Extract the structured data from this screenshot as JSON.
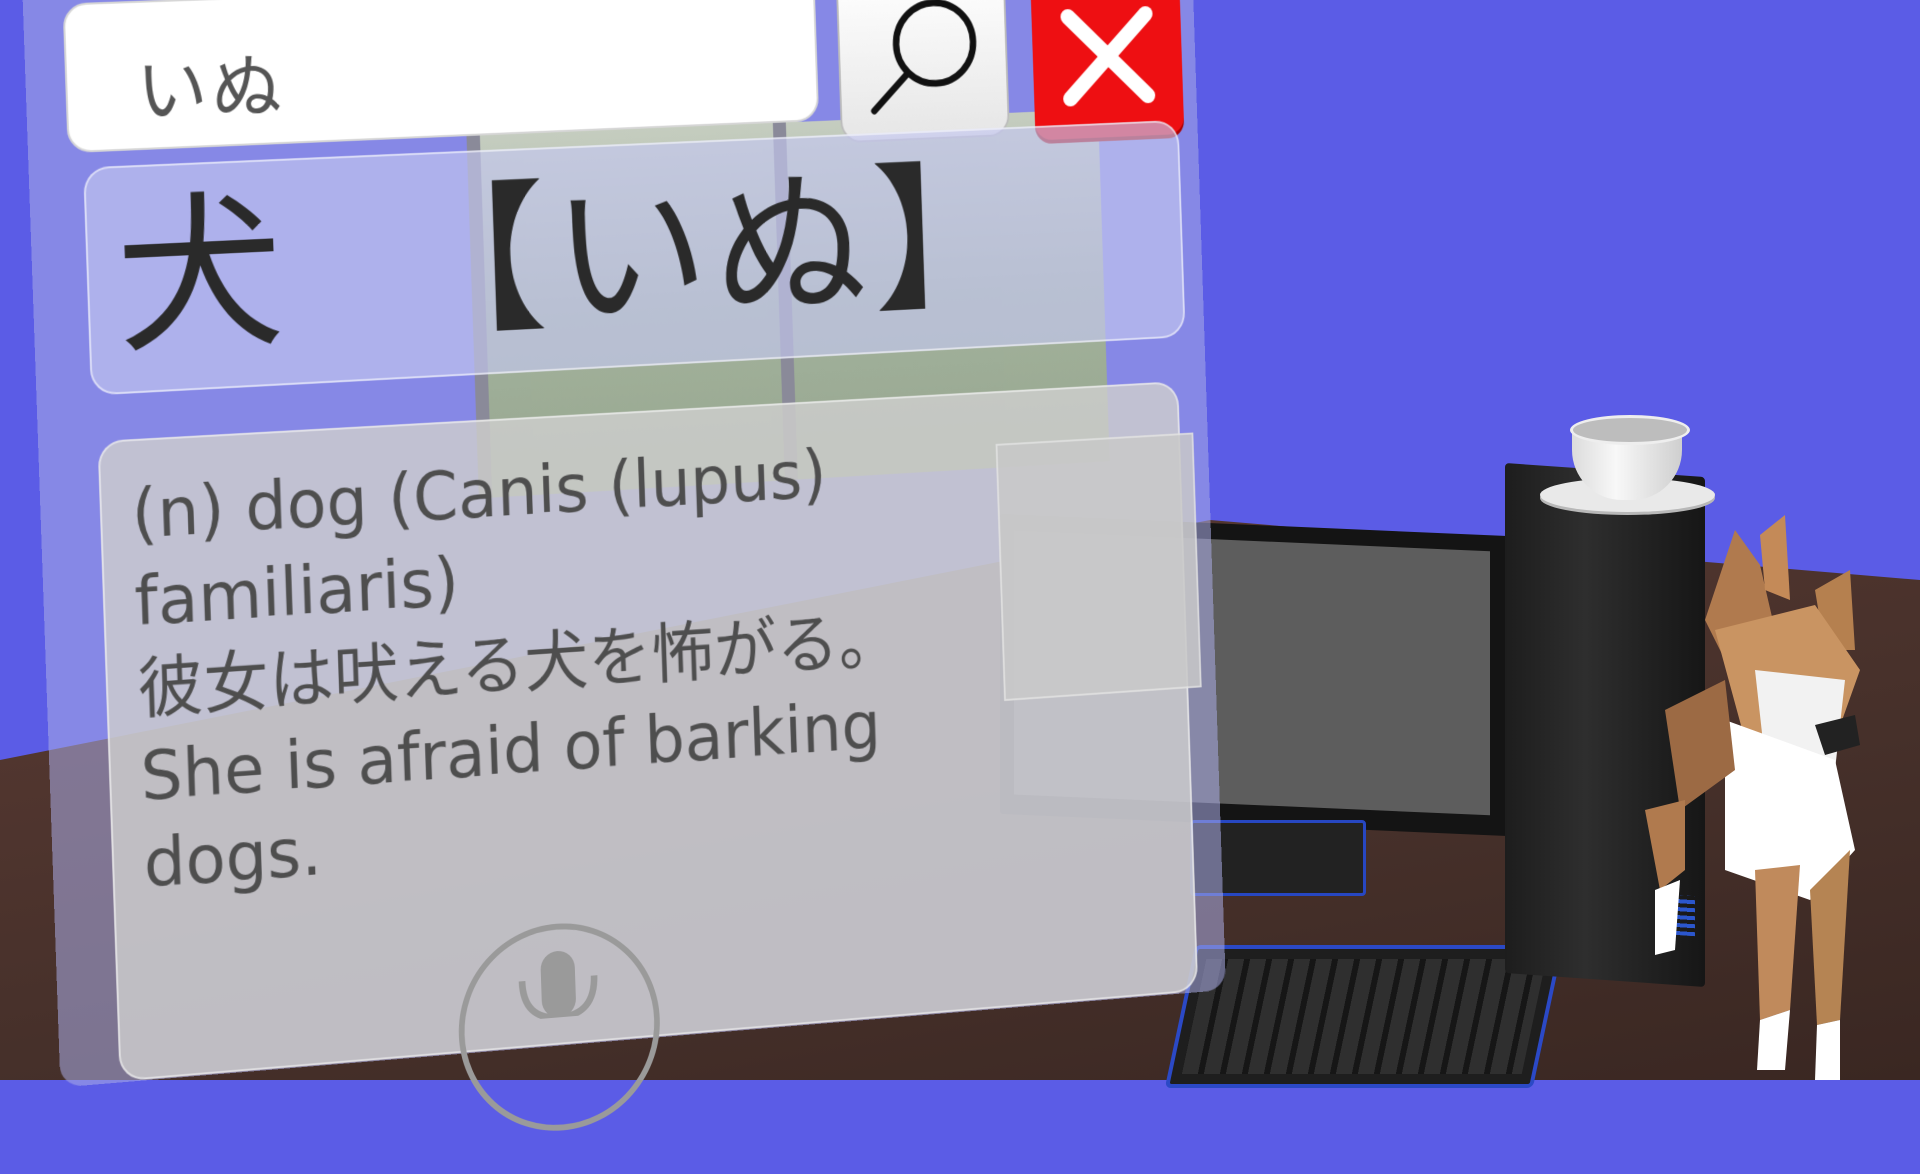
{
  "search": {
    "query": "いぬ",
    "search_icon": "search-icon",
    "close_icon": "close-icon"
  },
  "entry": {
    "kanji": "犬",
    "reading": "【いぬ】",
    "definition": "(n) dog (Canis (lupus)\nfamiliaris)\n彼女は吠える犬を怖がる。\nShe is afraid of barking\ndogs."
  },
  "controls": {
    "mic_icon": "microphone-icon"
  },
  "colors": {
    "background": "#5b5ce6",
    "close_button": "#ee0f12",
    "panel_tint": "#aaace6",
    "accent_blue": "#2b49c6"
  }
}
